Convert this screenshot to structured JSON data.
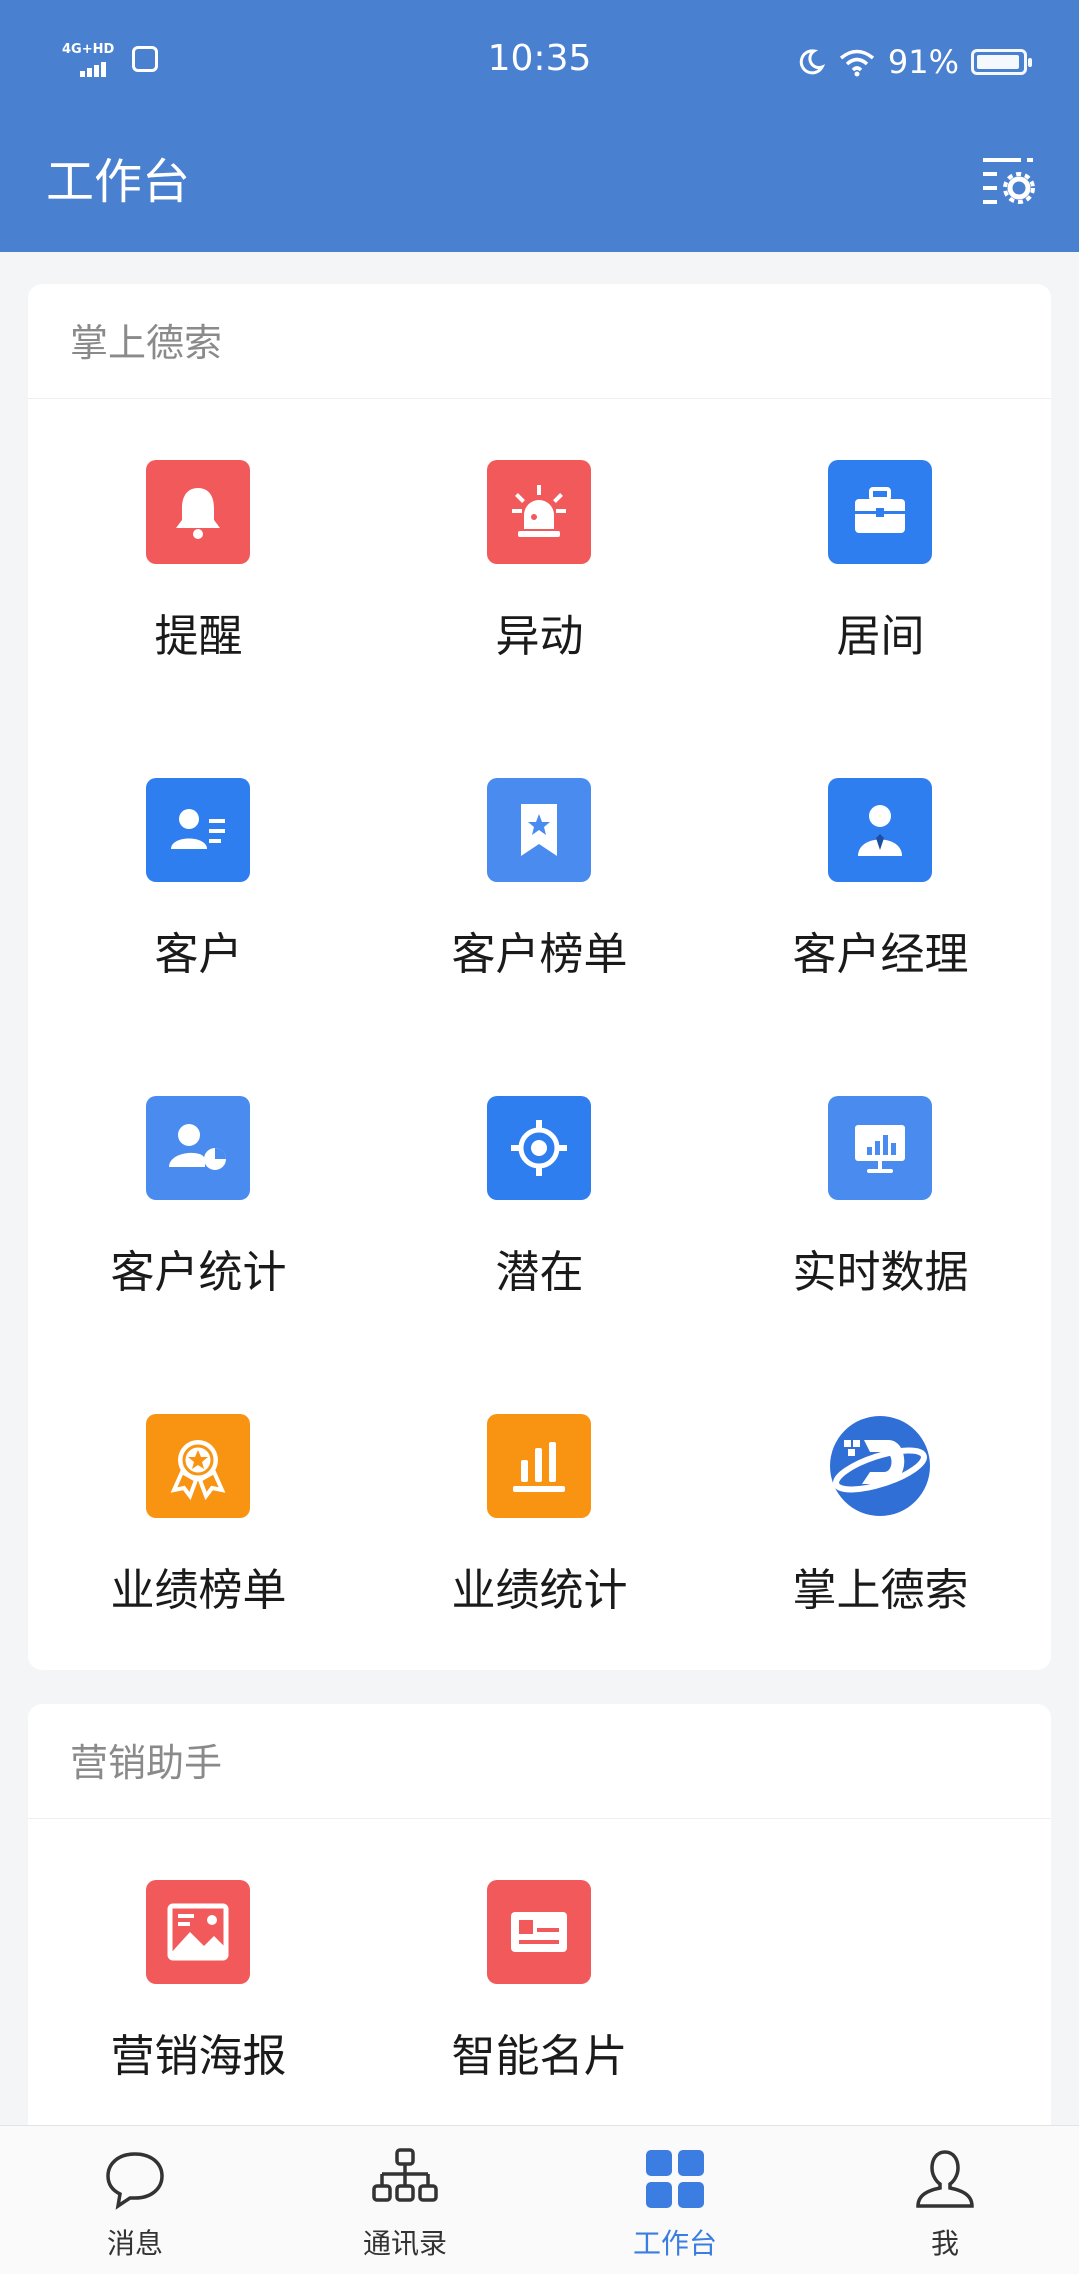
{
  "status_bar": {
    "network": "4G+HD",
    "time": "10:35",
    "battery": "91%",
    "battery_level": 0.91
  },
  "header": {
    "title": "工作台",
    "settings_icon": "filter-settings-icon"
  },
  "sections": [
    {
      "title": "掌上德索",
      "items": [
        {
          "label": "提醒",
          "icon": "bell-icon",
          "color": "#f2595a"
        },
        {
          "label": "异动",
          "icon": "alarm-light-icon",
          "color": "#f2595a"
        },
        {
          "label": "居间",
          "icon": "briefcase-icon",
          "color": "#2f7ef0"
        },
        {
          "label": "客户",
          "icon": "contact-card-icon",
          "color": "#2f7ef0"
        },
        {
          "label": "客户榜单",
          "icon": "bookmark-star-icon",
          "color": "#4a8bf0"
        },
        {
          "label": "客户经理",
          "icon": "manager-icon",
          "color": "#2f7ef0"
        },
        {
          "label": "客户统计",
          "icon": "user-chart-icon",
          "color": "#4a8bf0"
        },
        {
          "label": "潜在",
          "icon": "target-icon",
          "color": "#2f7ef0"
        },
        {
          "label": "实时数据",
          "icon": "presentation-chart-icon",
          "color": "#4a8bf0"
        },
        {
          "label": "业绩榜单",
          "icon": "award-medal-icon",
          "color": "#f89411"
        },
        {
          "label": "业绩统计",
          "icon": "bar-chart-icon",
          "color": "#f89411"
        },
        {
          "label": "掌上德索",
          "icon": "desuo-logo-icon",
          "color": "#2f6fd6"
        }
      ]
    },
    {
      "title": "营销助手",
      "items": [
        {
          "label": "营销海报",
          "icon": "poster-image-icon",
          "color": "#f2595a"
        },
        {
          "label": "智能名片",
          "icon": "business-card-icon",
          "color": "#f2595a"
        }
      ]
    }
  ],
  "tabbar": {
    "tabs": [
      {
        "label": "消息",
        "icon": "chat-bubble-icon",
        "active": false
      },
      {
        "label": "通讯录",
        "icon": "org-chart-icon",
        "active": false
      },
      {
        "label": "工作台",
        "icon": "grid-icon",
        "active": true
      },
      {
        "label": "我",
        "icon": "person-icon",
        "active": false
      }
    ],
    "active_color": "#3b7de0"
  }
}
